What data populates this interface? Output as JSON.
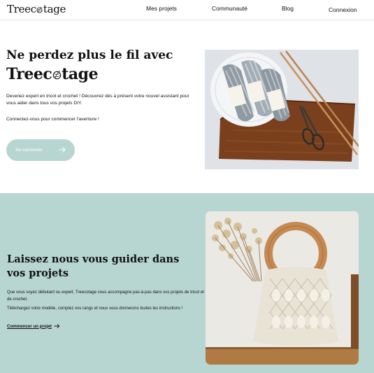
{
  "header": {
    "logo": {
      "prefix": "Treec",
      "suffix": "tage"
    },
    "nav": [
      {
        "label": "Mes projets"
      },
      {
        "label": "Communauté"
      },
      {
        "label": "Blog"
      },
      {
        "label": "Connexion"
      }
    ]
  },
  "hero": {
    "title_line1": "Ne perdez plus le fil avec",
    "title_brand_prefix": "Treec",
    "title_brand_suffix": "tage",
    "description": "Devenez expert en tricot et crochet ! Découvrez dès à présent votre nouvel assistant pour vous aider dans tous vos projets DIY.",
    "cta_text": "Connectez-vous pour commencer l'aventure !",
    "button_label": "Se connecter",
    "image": "yarn-skeins-knitting-needles-scissors-photo"
  },
  "guide": {
    "title": "Laissez nous vous guider dans vos projets",
    "paragraph1": "Que vous soyez débutant ou expert, Treecotage vous accompagne pas-à-pas dans vos projets de tricot et de crochet.",
    "paragraph2": "Téléchargez votre modèle, comptez vos rangs et nous vous donnerons toutes les instructions !",
    "link_label": "Commencer un projet",
    "image": "macrame-bag-dried-flowers-photo"
  },
  "colors": {
    "accent": "#b8d6d1",
    "text": "#111111",
    "button_text": "#ffffff"
  }
}
